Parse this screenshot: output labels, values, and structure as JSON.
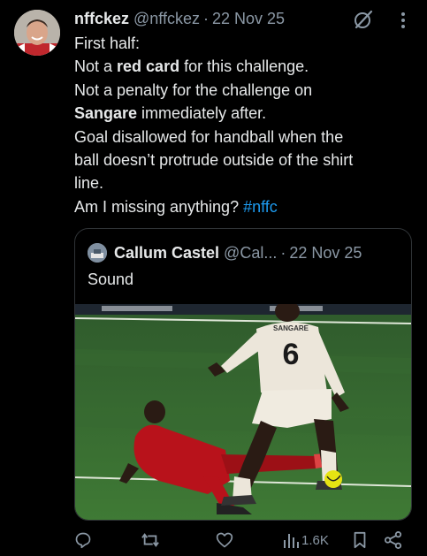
{
  "author": {
    "name": "nffckez",
    "handle": "@nffckez",
    "separator": "·",
    "date": "22 Nov 25",
    "avatar_icon": "user-avatar-photo"
  },
  "tweet": {
    "line1": "First half:",
    "line2_pre": "Not a ",
    "line2_bold": "red card",
    "line2_post": " for this challenge.",
    "line3": "Not a penalty for the challenge on",
    "line4_bold": "Sangare",
    "line4_post": " immediately after.",
    "line5": "Goal disallowed for handball when the",
    "line6": "ball doesn’t protrude outside of the shirt",
    "line7": "line.",
    "line8_pre": "Am I missing anything? ",
    "hashtag": "#nffc"
  },
  "quote": {
    "name": "Callum Castel",
    "handle": "@Cal...",
    "separator": "·",
    "date": "22 Nov 25",
    "text": "Sound",
    "image": {
      "jersey_name": "SANGARE",
      "jersey_number": "6"
    }
  },
  "actions": {
    "views": "1.6K",
    "icons": [
      "reply-icon",
      "retweet-icon",
      "like-icon",
      "views-icon",
      "bookmark-icon",
      "share-icon"
    ]
  },
  "colors": {
    "background": "#000000",
    "text": "#e7e9ea",
    "secondary": "#8b98a5",
    "link": "#1d9bf0",
    "border": "#2f3336"
  }
}
